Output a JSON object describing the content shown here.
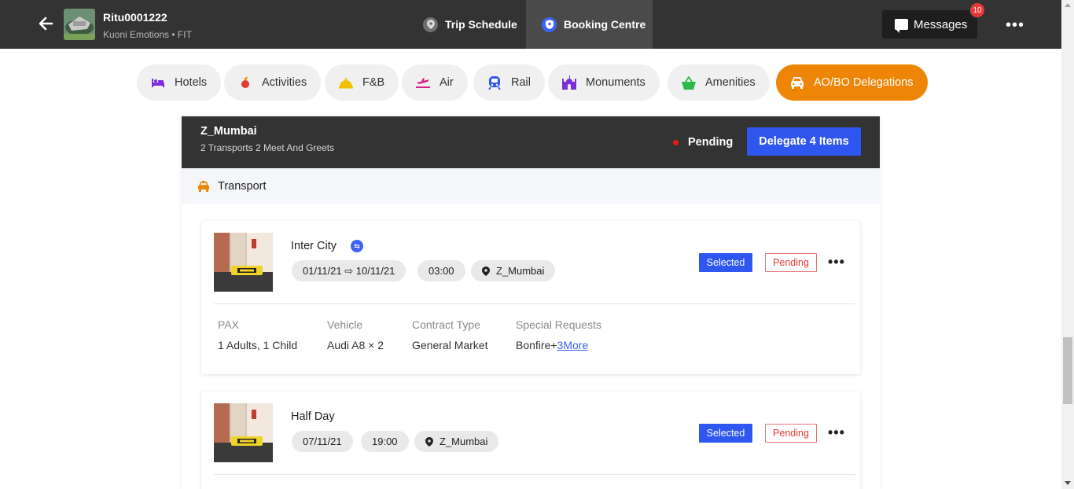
{
  "header": {
    "trip_name": "Ritu0001222",
    "trip_sub": "Kuoni Emotions • FIT",
    "tabs": [
      {
        "label": "Trip Schedule",
        "icon": "location-pin-icon",
        "active": false
      },
      {
        "label": "Booking Centre",
        "icon": "shield-icon",
        "active": true
      }
    ],
    "messages_label": "Messages",
    "messages_badge": "10"
  },
  "categories": [
    {
      "label": "Hotels",
      "icon": "bed-icon",
      "color": "#7b2fd6"
    },
    {
      "label": "Activities",
      "icon": "activity-icon",
      "color": "#e53935"
    },
    {
      "label": "F&B",
      "icon": "cloche-icon",
      "color": "#f2c200"
    },
    {
      "label": "Air",
      "icon": "plane-icon",
      "color": "#e0208a"
    },
    {
      "label": "Rail",
      "icon": "train-icon",
      "color": "#3056f0"
    },
    {
      "label": "Monuments",
      "icon": "monument-icon",
      "color": "#7b2fd6"
    },
    {
      "label": "Amenities",
      "icon": "basket-icon",
      "color": "#2db84a"
    },
    {
      "label": "AO/BO Delegations",
      "icon": "car-icon",
      "color": "#ffffff",
      "active": true
    }
  ],
  "panel": {
    "title": "Z_Mumbai",
    "subtitle": "2 Transports 2 Meet And Greets",
    "status": "Pending",
    "delegate_label": "Delegate 4 Items",
    "section_label": "Transport"
  },
  "cards": [
    {
      "title": "Inter City",
      "dates": "01/11/21 ⇨ 10/11/21",
      "time": "03:00",
      "location": "Z_Mumbai",
      "selected": "Selected",
      "status": "Pending",
      "details": {
        "pax_label": "PAX",
        "pax_value": "1 Adults, 1 Child",
        "vehicle_label": "Vehicle",
        "vehicle_value": "Audi A8 × 2",
        "contract_label": "Contract Type",
        "contract_value": "General Market",
        "requests_label": "Special Requests",
        "requests_value": "Bonfire+",
        "requests_more": "3More"
      }
    },
    {
      "title": "Half Day",
      "dates": "07/11/21",
      "time": "19:00",
      "location": "Z_Mumbai",
      "selected": "Selected",
      "status": "Pending"
    }
  ]
}
